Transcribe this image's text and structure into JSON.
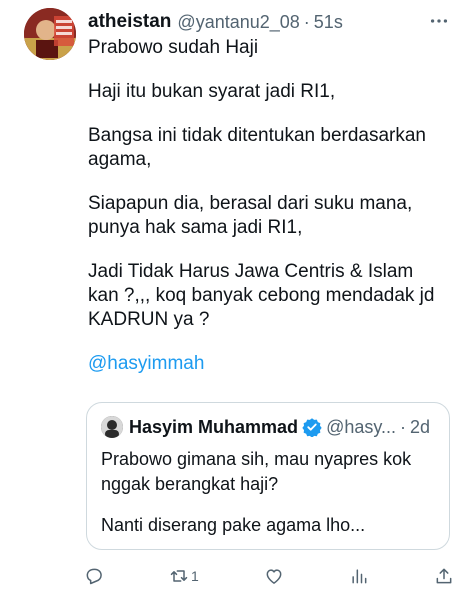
{
  "author": {
    "display_name": "atheistan",
    "handle": "@yantanu2_08",
    "separator": "·",
    "time": "51s",
    "avatar_icon": "profile-photo"
  },
  "tweet": {
    "paragraphs": [
      "Prabowo sudah Haji",
      "Haji itu bukan syarat jadi RI1,",
      "Bangsa ini tidak ditentukan berdasarkan\nagama,",
      "Siapapun dia, berasal dari suku mana,\npunya hak sama jadi RI1,",
      "Jadi Tidak Harus Jawa Centris & Islam\nkan ?,,, koq banyak cebong mendadak jd\nKADRUN ya ?"
    ],
    "mention": "@hasyimmah"
  },
  "quote": {
    "display_name": "Hasyim Muhammad",
    "handle": "@hasy...",
    "separator": "·",
    "time": "2d",
    "verified": true,
    "paragraphs": [
      "Prabowo gimana sih, mau nyapres kok\nnggak berangkat haji?",
      "Nanti diserang pake agama lho..."
    ]
  },
  "actions": {
    "reply_icon": "reply-icon",
    "retweet_icon": "retweet-icon",
    "retweet_count": "1",
    "like_icon": "like-icon",
    "views_icon": "views-icon",
    "share_icon": "share-icon"
  },
  "colors": {
    "text": "#0f1419",
    "secondary": "#536471",
    "accent": "#1d9bf0",
    "border": "#cfd9de"
  }
}
